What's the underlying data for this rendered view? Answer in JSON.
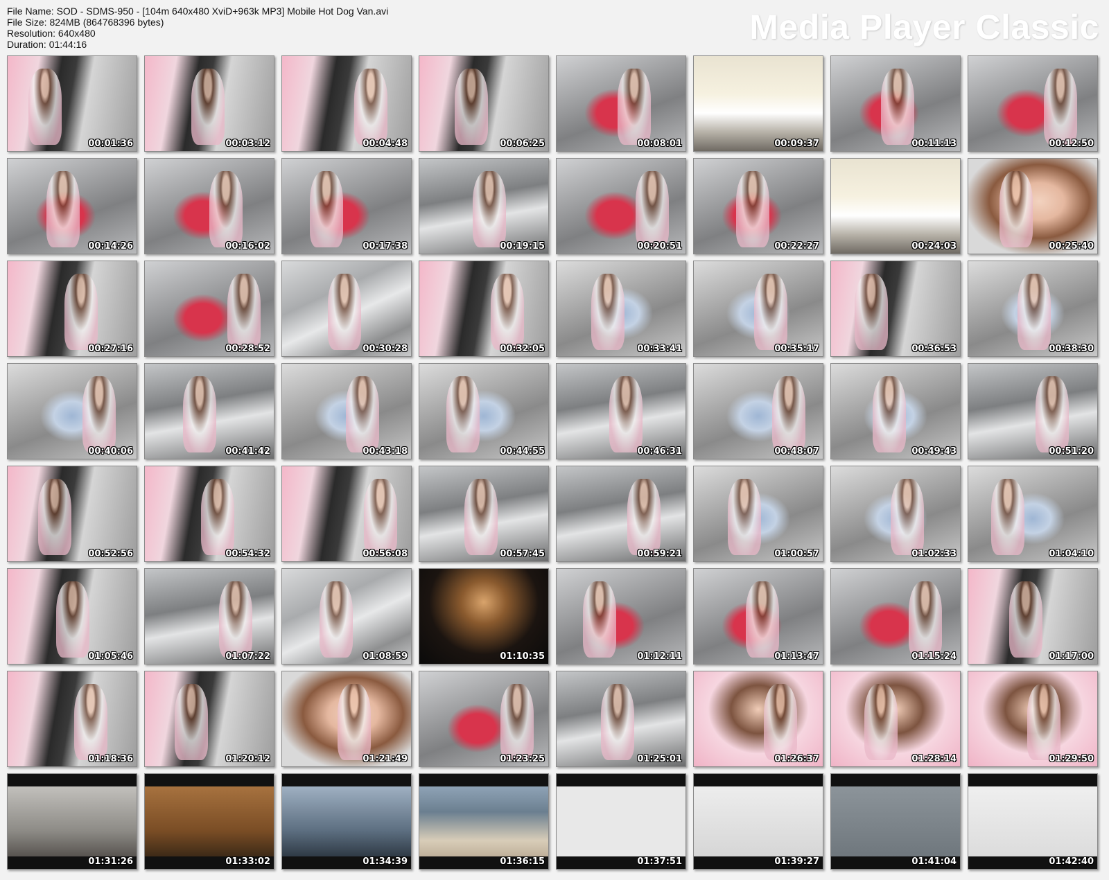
{
  "file_info": {
    "file_name": "File Name: SOD - SDMS-950 - [104m 640x480 XviD+963k MP3]   Mobile Hot Dog Van.avi",
    "file_size": "File Size: 824MB (864768396 bytes)",
    "resolution": "Resolution: 640x480",
    "duration": "Duration: 01:44:16"
  },
  "brand": "Media Player Classic",
  "thumbnails": [
    {
      "time": "00:01:36",
      "scene": "pink"
    },
    {
      "time": "00:03:12",
      "scene": "pink"
    },
    {
      "time": "00:04:48",
      "scene": "pink"
    },
    {
      "time": "00:06:25",
      "scene": "pink"
    },
    {
      "time": "00:08:01",
      "scene": "red"
    },
    {
      "time": "00:09:37",
      "scene": "out"
    },
    {
      "time": "00:11:13",
      "scene": "red"
    },
    {
      "time": "00:12:50",
      "scene": "red"
    },
    {
      "time": "00:14:26",
      "scene": "red"
    },
    {
      "time": "00:16:02",
      "scene": "red"
    },
    {
      "time": "00:17:38",
      "scene": "red"
    },
    {
      "time": "00:19:15",
      "scene": "low"
    },
    {
      "time": "00:20:51",
      "scene": "red"
    },
    {
      "time": "00:22:27",
      "scene": "red"
    },
    {
      "time": "00:24:03",
      "scene": "out"
    },
    {
      "time": "00:25:40",
      "scene": "face"
    },
    {
      "time": "00:27:16",
      "scene": "pink"
    },
    {
      "time": "00:28:52",
      "scene": "red"
    },
    {
      "time": "00:30:28",
      "scene": "van"
    },
    {
      "time": "00:32:05",
      "scene": "pink"
    },
    {
      "time": "00:33:41",
      "scene": "blue"
    },
    {
      "time": "00:35:17",
      "scene": "blue"
    },
    {
      "time": "00:36:53",
      "scene": "pink"
    },
    {
      "time": "00:38:30",
      "scene": "blue"
    },
    {
      "time": "00:40:06",
      "scene": "blue"
    },
    {
      "time": "00:41:42",
      "scene": "low"
    },
    {
      "time": "00:43:18",
      "scene": "blue"
    },
    {
      "time": "00:44:55",
      "scene": "blue"
    },
    {
      "time": "00:46:31",
      "scene": "low"
    },
    {
      "time": "00:48:07",
      "scene": "blue"
    },
    {
      "time": "00:49:43",
      "scene": "blue"
    },
    {
      "time": "00:51:20",
      "scene": "low"
    },
    {
      "time": "00:52:56",
      "scene": "pink"
    },
    {
      "time": "00:54:32",
      "scene": "pink"
    },
    {
      "time": "00:56:08",
      "scene": "pink"
    },
    {
      "time": "00:57:45",
      "scene": "low"
    },
    {
      "time": "00:59:21",
      "scene": "low"
    },
    {
      "time": "01:00:57",
      "scene": "blue"
    },
    {
      "time": "01:02:33",
      "scene": "blue"
    },
    {
      "time": "01:04:10",
      "scene": "blue"
    },
    {
      "time": "01:05:46",
      "scene": "pink"
    },
    {
      "time": "01:07:22",
      "scene": "low"
    },
    {
      "time": "01:08:59",
      "scene": "van"
    },
    {
      "time": "01:10:35",
      "scene": "dark"
    },
    {
      "time": "01:12:11",
      "scene": "red"
    },
    {
      "time": "01:13:47",
      "scene": "red"
    },
    {
      "time": "01:15:24",
      "scene": "red"
    },
    {
      "time": "01:17:00",
      "scene": "pink"
    },
    {
      "time": "01:18:36",
      "scene": "pink"
    },
    {
      "time": "01:20:12",
      "scene": "pink"
    },
    {
      "time": "01:21:49",
      "scene": "face"
    },
    {
      "time": "01:23:25",
      "scene": "red"
    },
    {
      "time": "01:25:01",
      "scene": "low"
    },
    {
      "time": "01:26:37",
      "scene": "maid"
    },
    {
      "time": "01:28:14",
      "scene": "maid"
    },
    {
      "time": "01:29:50",
      "scene": "maid"
    },
    {
      "time": "01:31:26",
      "scene": "street"
    },
    {
      "time": "01:33:02",
      "scene": "wood"
    },
    {
      "time": "01:34:39",
      "scene": "stat"
    },
    {
      "time": "01:36:15",
      "scene": "beach"
    },
    {
      "time": "01:37:51",
      "scene": "tred"
    },
    {
      "time": "01:39:27",
      "scene": "cups"
    },
    {
      "time": "01:41:04",
      "scene": "qw"
    },
    {
      "time": "01:42:40",
      "scene": "white"
    }
  ]
}
